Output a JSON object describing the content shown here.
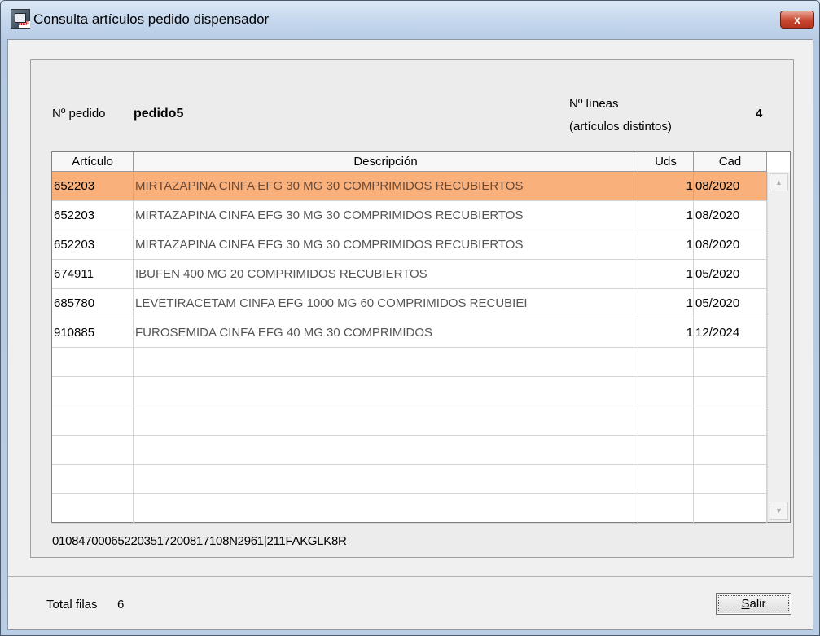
{
  "window": {
    "title": "Consulta artículos pedido dispensador",
    "close_label": "x",
    "app_icon_tag": "NEF"
  },
  "header": {
    "pedido_label": "Nº pedido",
    "pedido_value": "pedido5",
    "lineas_label_1": "Nº líneas",
    "lineas_label_2": "(artículos distintos)",
    "lineas_value": "4"
  },
  "table": {
    "columns": [
      "Artículo",
      "Descripción",
      "Uds",
      "Cad"
    ],
    "rows": [
      {
        "articulo": "652203",
        "descripcion": "MIRTAZAPINA CINFA EFG 30 MG 30 COMPRIMIDOS RECUBIERTOS",
        "uds": "1",
        "cad": "08/2020"
      },
      {
        "articulo": "652203",
        "descripcion": "MIRTAZAPINA CINFA EFG 30 MG 30 COMPRIMIDOS RECUBIERTOS",
        "uds": "1",
        "cad": "08/2020"
      },
      {
        "articulo": "652203",
        "descripcion": "MIRTAZAPINA CINFA EFG 30 MG 30 COMPRIMIDOS RECUBIERTOS",
        "uds": "1",
        "cad": "08/2020"
      },
      {
        "articulo": "674911",
        "descripcion": "IBUFEN 400 MG 20 COMPRIMIDOS RECUBIERTOS",
        "uds": "1",
        "cad": "05/2020"
      },
      {
        "articulo": "685780",
        "descripcion": "LEVETIRACETAM CINFA EFG 1000 MG 60 COMPRIMIDOS RECUBIEI",
        "uds": "1",
        "cad": "05/2020"
      },
      {
        "articulo": "910885",
        "descripcion": "FUROSEMIDA CINFA EFG 40 MG 30 COMPRIMIDOS",
        "uds": "1",
        "cad": "12/2024"
      },
      {
        "articulo": "",
        "descripcion": "",
        "uds": "",
        "cad": ""
      },
      {
        "articulo": "",
        "descripcion": "",
        "uds": "",
        "cad": ""
      },
      {
        "articulo": "",
        "descripcion": "",
        "uds": "",
        "cad": ""
      },
      {
        "articulo": "",
        "descripcion": "",
        "uds": "",
        "cad": ""
      },
      {
        "articulo": "",
        "descripcion": "",
        "uds": "",
        "cad": ""
      },
      {
        "articulo": "",
        "descripcion": "",
        "uds": "",
        "cad": ""
      }
    ],
    "selected_row_index": 0,
    "selected_color": "#f9b07a"
  },
  "barcode_text": "010847000652203517200817108N2961|211FAKGLK8R",
  "footer": {
    "total_label": "Total filas",
    "total_value": "6",
    "salir_label": "alir",
    "salir_mnemonic": "S"
  },
  "icons": {
    "scroll_up": "▲",
    "scroll_down": "▼"
  }
}
